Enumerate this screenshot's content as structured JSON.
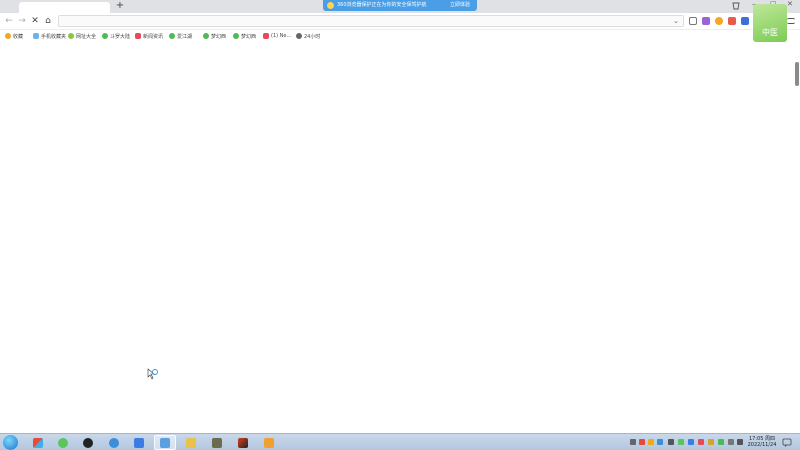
{
  "browser": {
    "new_tab": "+",
    "notification": {
      "text": "360浏览器保护正在为你的安全保驾护航",
      "button": "立即体验"
    },
    "toolbar": {
      "back": "←",
      "forward": "→",
      "stop": "✕",
      "home": "⌂",
      "omnibox_value": "",
      "omnibox_dropdown": "⌄"
    },
    "bookmarks": [
      {
        "label": "收藏",
        "icon": "star-icon",
        "color": "#f0a81c"
      },
      {
        "label": "手机收藏夹",
        "icon": "phone-icon",
        "color": "#6ab3ef"
      },
      {
        "label": "网址大全",
        "icon": "globe-icon",
        "color": "#8cc63f"
      },
      {
        "label": "斗罗大陆",
        "icon": "play-icon",
        "color": "#4dbb55"
      },
      {
        "label": "新闻资讯",
        "icon": "news-icon",
        "color": "#e64a5b"
      },
      {
        "label": "爱江湖",
        "icon": "play-icon",
        "color": "#4dbb55"
      },
      {
        "label": "梦幻西",
        "icon": "play-icon",
        "color": "#4dbb55"
      },
      {
        "label": "梦幻西",
        "icon": "play-icon",
        "color": "#4dbb55"
      },
      {
        "label": "(1) Ne...",
        "icon": "news-icon",
        "color": "#e64a5b"
      },
      {
        "label": "24小时",
        "icon": "clock-icon",
        "color": "#666666"
      }
    ],
    "logo_text": "中医",
    "window_controls": {
      "minimize": "—",
      "maximize": "□",
      "close": "✕"
    }
  },
  "taskbar": {
    "clock_time": "17:05 周四",
    "clock_date": "2022/11/24"
  },
  "colors": {
    "tabstrip": "#dfe1e5",
    "notification": "#4a9ee6",
    "taskbar": "#c2d3e8",
    "scrollbar": "#8a8a8a"
  }
}
